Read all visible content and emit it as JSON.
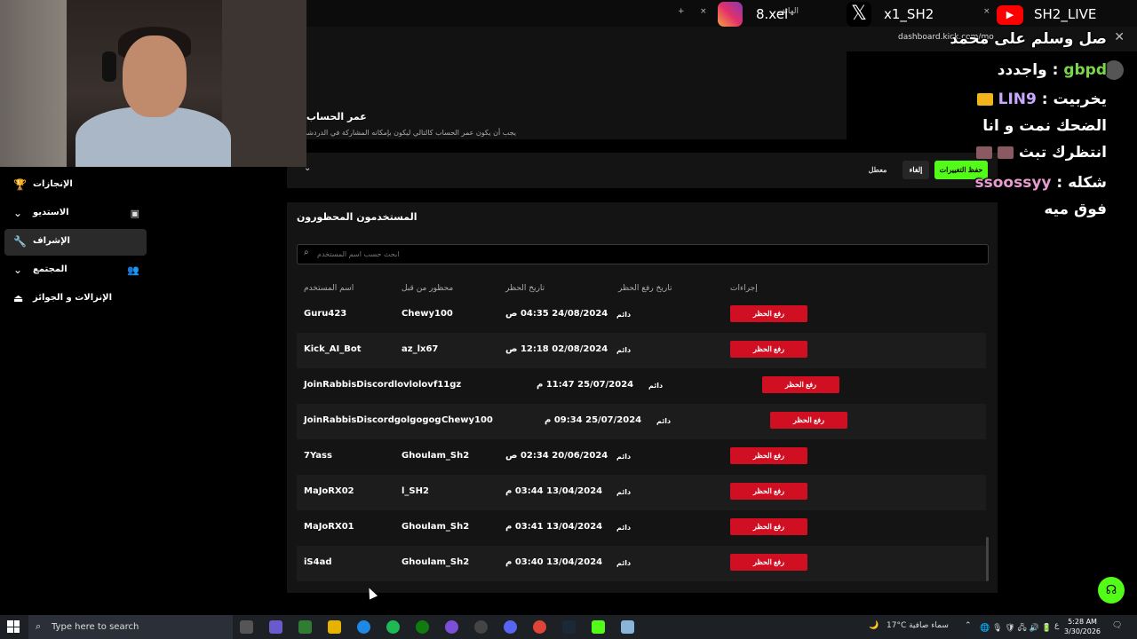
{
  "browser": {
    "tabs": [
      "+",
      "×",
      "الهاتف",
      "×"
    ],
    "url": "dashboard.kick.com/mo"
  },
  "sidebar": {
    "items": [
      {
        "label": "الإنجازات",
        "icon": "trophy-icon"
      },
      {
        "label": "الاستديو",
        "icon": "studio-icon"
      },
      {
        "label": "الإشراف",
        "icon": "wrench-icon"
      },
      {
        "label": "المجتمع",
        "icon": "community-icon"
      },
      {
        "label": "الإنزالات و الجوائز",
        "icon": "drops-icon"
      }
    ]
  },
  "settings": {
    "account_age_title": "عمر الحساب",
    "account_age_desc": "يجب أن يكون عمر الحساب كالتالي ليكون بإمكانه المشاركة في الدردشة",
    "save_label": "حفظ التغييرات",
    "cancel_label": "إلغاء",
    "disabled_label": "معطل"
  },
  "banned": {
    "title": "المستخدمون المحظورون",
    "search_placeholder": "ابحث حسب اسم المستخدم",
    "columns": [
      "اسم المستخدم",
      "محظور من قبل",
      "تاريخ الحظر",
      "تاريخ رفع الحظر",
      "إجراءات"
    ],
    "unban_label": "رفع الحظر",
    "rows": [
      {
        "user": "Guru423",
        "by": "Chewy100",
        "date": "24/08/2024 04:35 ص",
        "until": "دائم"
      },
      {
        "user": "Kick_AI_Bot",
        "by": "az_lx67",
        "date": "02/08/2024 12:18 ص",
        "until": "دائم"
      },
      {
        "user": "JoinRabbisDiscordlovlolov",
        "by": "f11gz",
        "date": "25/07/2024 11:47 م",
        "until": "دائم"
      },
      {
        "user": "JoinRabbisDiscordgolgogog",
        "by": "Chewy100",
        "date": "25/07/2024 09:34 م",
        "until": "دائم"
      },
      {
        "user": "7Yass",
        "by": "Ghoulam_Sh2",
        "date": "20/06/2024 02:34 ص",
        "until": "دائم"
      },
      {
        "user": "MaJoRX02",
        "by": "l_SH2",
        "date": "13/04/2024 03:44 م",
        "until": "دائم"
      },
      {
        "user": "MaJoRX01",
        "by": "Ghoulam_Sh2",
        "date": "13/04/2024 03:41 م",
        "until": "دائم"
      },
      {
        "user": "iS4ad",
        "by": "Ghoulam_Sh2",
        "date": "13/04/2024 03:40 م",
        "until": "دائم"
      }
    ]
  },
  "overlay": {
    "instagram": "8.xel",
    "x": "x1_SH2",
    "youtube": "SH2_LIVE",
    "chat": [
      {
        "text": "صل وسلم على محمد"
      },
      {
        "name": "gbpd",
        "text": "واجددد"
      },
      {
        "name": "LIN9",
        "text": "يخربيت"
      },
      {
        "text": "الضحك نمت و انا"
      },
      {
        "text": "انتظرك تبث"
      },
      {
        "name": "ssoossyy",
        "text": "شكله"
      },
      {
        "text": "فوق ميه"
      }
    ]
  },
  "taskbar": {
    "search_placeholder": "Type here to search",
    "weather": "17°C  سماء صافية",
    "lang": "ع",
    "time": "5:28 AM",
    "date": "3/30/2026"
  }
}
